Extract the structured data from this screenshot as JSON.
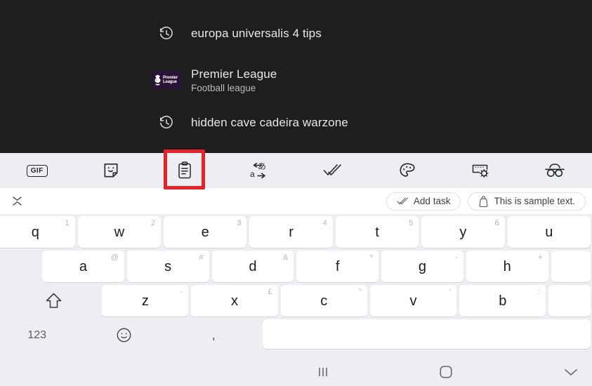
{
  "search_suggestions": {
    "items": [
      {
        "type": "history",
        "icon": "history-clock-icon",
        "title": "europa universalis 4 tips",
        "subtitle": ""
      },
      {
        "type": "entity",
        "icon": "premier-league-logo",
        "logo_text_line1": "Premier",
        "logo_text_line2": "League",
        "title": "Premier League",
        "subtitle": "Football league"
      },
      {
        "type": "history",
        "icon": "history-clock-icon",
        "title": "hidden cave cadeira warzone",
        "subtitle": ""
      }
    ]
  },
  "keyboard_toolbar": {
    "items": [
      {
        "name": "gif-button",
        "label": "GIF",
        "icon": "gif-icon"
      },
      {
        "name": "sticker-button",
        "label": "Stickers",
        "icon": "sticker-icon"
      },
      {
        "name": "clipboard-button",
        "label": "Clipboard",
        "icon": "clipboard-icon",
        "highlighted": true
      },
      {
        "name": "translate-button",
        "label": "Translate",
        "icon": "translate-icon"
      },
      {
        "name": "spell-check-button",
        "label": "Spell check",
        "icon": "double-check-icon"
      },
      {
        "name": "theme-button",
        "label": "Themes",
        "icon": "palette-icon"
      },
      {
        "name": "keyboard-settings-button",
        "label": "Keyboard settings",
        "icon": "keyboard-gear-icon"
      },
      {
        "name": "incognito-button",
        "label": "Incognito mode",
        "icon": "incognito-glasses-icon"
      }
    ],
    "highlight_color": "#e8222a"
  },
  "suggestion_strip": {
    "collapse_icon": "expand-collapse-icon",
    "chips": [
      {
        "name": "add-task-chip",
        "icon": "double-check-icon",
        "label": "Add task"
      },
      {
        "name": "clipboard-text-chip",
        "icon": "clipboard-bag-icon",
        "label": "This is sample text."
      }
    ]
  },
  "keyboard": {
    "row1": [
      {
        "key": "q",
        "alt": "1"
      },
      {
        "key": "w",
        "alt": "2"
      },
      {
        "key": "e",
        "alt": "3"
      },
      {
        "key": "r",
        "alt": "4"
      },
      {
        "key": "t",
        "alt": "5"
      },
      {
        "key": "y",
        "alt": "6"
      },
      {
        "key": "u",
        "alt": ""
      }
    ],
    "row2": [
      {
        "key": "a",
        "alt": "@"
      },
      {
        "key": "s",
        "alt": "#"
      },
      {
        "key": "d",
        "alt": "&"
      },
      {
        "key": "f",
        "alt": "*"
      },
      {
        "key": "g",
        "alt": "-"
      },
      {
        "key": "h",
        "alt": "+"
      },
      {
        "key": "",
        "alt": ""
      }
    ],
    "row3": [
      {
        "key": "shift",
        "alt": "",
        "icon": "shift-arrow-icon"
      },
      {
        "key": "z",
        "alt": "-"
      },
      {
        "key": "x",
        "alt": "£"
      },
      {
        "key": "c",
        "alt": "\""
      },
      {
        "key": "v",
        "alt": "'"
      },
      {
        "key": "b",
        "alt": ":"
      },
      {
        "key": "",
        "alt": ""
      }
    ],
    "row4": [
      {
        "key": "123",
        "alt": "",
        "label": "123"
      },
      {
        "key": "emoji",
        "alt": "",
        "icon": "smiley-icon"
      },
      {
        "key": ",",
        "alt": "",
        "label": ","
      },
      {
        "key": "space",
        "alt": "",
        "label": ""
      }
    ]
  },
  "navigation_bar": {
    "recents_label": "|||",
    "recents_icon": "recents-icon",
    "home_icon": "home-square-icon",
    "hide_keyboard_icon": "chevron-down-icon"
  },
  "colors": {
    "dark_panel": "#1e1e1e",
    "keyboard_bg": "#eceef1",
    "key_face": "#ffffff",
    "strip_bg": "#ffffff",
    "highlight": "#e8222a"
  }
}
